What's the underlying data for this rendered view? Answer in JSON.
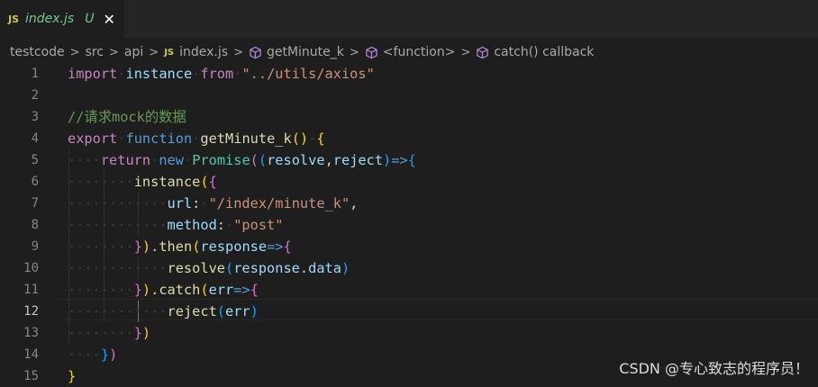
{
  "tab": {
    "badge": "JS",
    "filename": "index.js",
    "status": "U",
    "close_glyph": "✕"
  },
  "breadcrumb": {
    "items": [
      "testcode",
      "src",
      "api",
      "index.js",
      "getMinute_k",
      "<function>",
      "catch() callback"
    ],
    "js_badge": "JS",
    "separator": ">"
  },
  "editor": {
    "line_numbers": [
      "1",
      "2",
      "3",
      "4",
      "5",
      "6",
      "7",
      "8",
      "9",
      "10",
      "11",
      "12",
      "13",
      "14",
      "15"
    ],
    "active_line": "12"
  },
  "code": {
    "l1": {
      "import": "import",
      "instance": "instance",
      "from": "from",
      "path": "\"../utils/axios\""
    },
    "l3": {
      "comment": "//请求mock的数据"
    },
    "l4": {
      "export": "export",
      "function": "function",
      "name": "getMinute_k",
      "parens": "()",
      "brace": "{"
    },
    "l5": {
      "return": "return",
      "new": "new",
      "promise": "Promise",
      "p1": "(",
      "p2": "(",
      "resolve": "resolve",
      "comma": ",",
      "reject": "reject",
      "p3": ")",
      "arrow": "=>",
      "brace": "{"
    },
    "l6": {
      "instance": "instance",
      "p": "(",
      "brace": "{"
    },
    "l7": {
      "key": "url",
      "colon": ":",
      "value": "\"/index/minute_k\"",
      "comma": ","
    },
    "l8": {
      "key": "method",
      "colon": ":",
      "value": "\"post\""
    },
    "l9": {
      "brace": "}",
      "p": ")",
      "dot": ".",
      "then": "then",
      "p2": "(",
      "response": "response",
      "arrow": "=>",
      "brace2": "{"
    },
    "l10": {
      "resolve": "resolve",
      "p": "(",
      "obj": "response",
      "dot": ".",
      "prop": "data",
      "p2": ")"
    },
    "l11": {
      "brace": "}",
      "p": ")",
      "dot": ".",
      "catch": "catch",
      "p2": "(",
      "err": "err",
      "arrow": "=>",
      "brace2": "{"
    },
    "l12": {
      "reject": "reject",
      "p": "(",
      "err": "err",
      "p2": ")"
    },
    "l13": {
      "brace": "}",
      "p": ")"
    },
    "l14": {
      "brace": "}",
      "p": ")"
    },
    "l15": {
      "brace": "}"
    }
  },
  "watermark": "CSDN @专心致志的程序员！"
}
